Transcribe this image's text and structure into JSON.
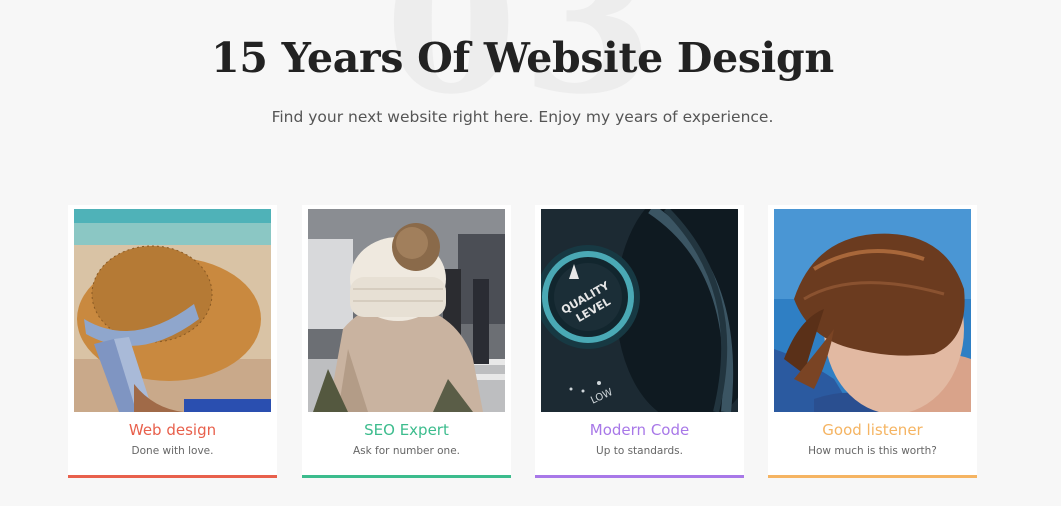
{
  "header": {
    "background_number": "03",
    "title": "15 Years Of Website Design",
    "subtitle": "Find your next website right here. Enjoy my years of experience."
  },
  "cards": [
    {
      "title": "Web design",
      "description": "Done with love.",
      "accent": "#e8604c",
      "image": "straw-hat-woman-photo"
    },
    {
      "title": "SEO Expert",
      "description": "Ask for number one.",
      "accent": "#3cbc8d",
      "image": "winter-hat-woman-photo"
    },
    {
      "title": "Modern Code",
      "description": "Up to standards.",
      "accent": "#a878e8",
      "image": "quality-level-knob-photo"
    },
    {
      "title": "Good listener",
      "description": "How much is this worth?",
      "accent": "#f5b462",
      "image": "ponytail-woman-photo"
    }
  ],
  "photo_text": {
    "knob_line1": "QUALITY",
    "knob_line2": "LEVEL",
    "knob_low": "LOW"
  }
}
